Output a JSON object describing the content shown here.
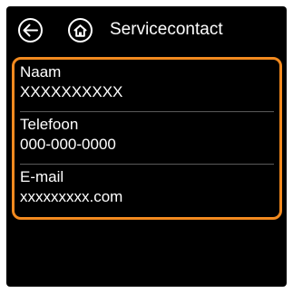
{
  "header": {
    "title": "Servicecontact",
    "back_icon": "back-arrow-icon",
    "home_icon": "home-icon"
  },
  "colors": {
    "background": "#000000",
    "accent": "#f28a1f",
    "text": "#ffffff"
  },
  "contact": {
    "fields": [
      {
        "label": "Naam",
        "value": "XXXXXXXXXX"
      },
      {
        "label": "Telefoon",
        "value": "000-000-0000"
      },
      {
        "label": "E-mail",
        "value": "xxxxxxxxx.com"
      }
    ]
  }
}
